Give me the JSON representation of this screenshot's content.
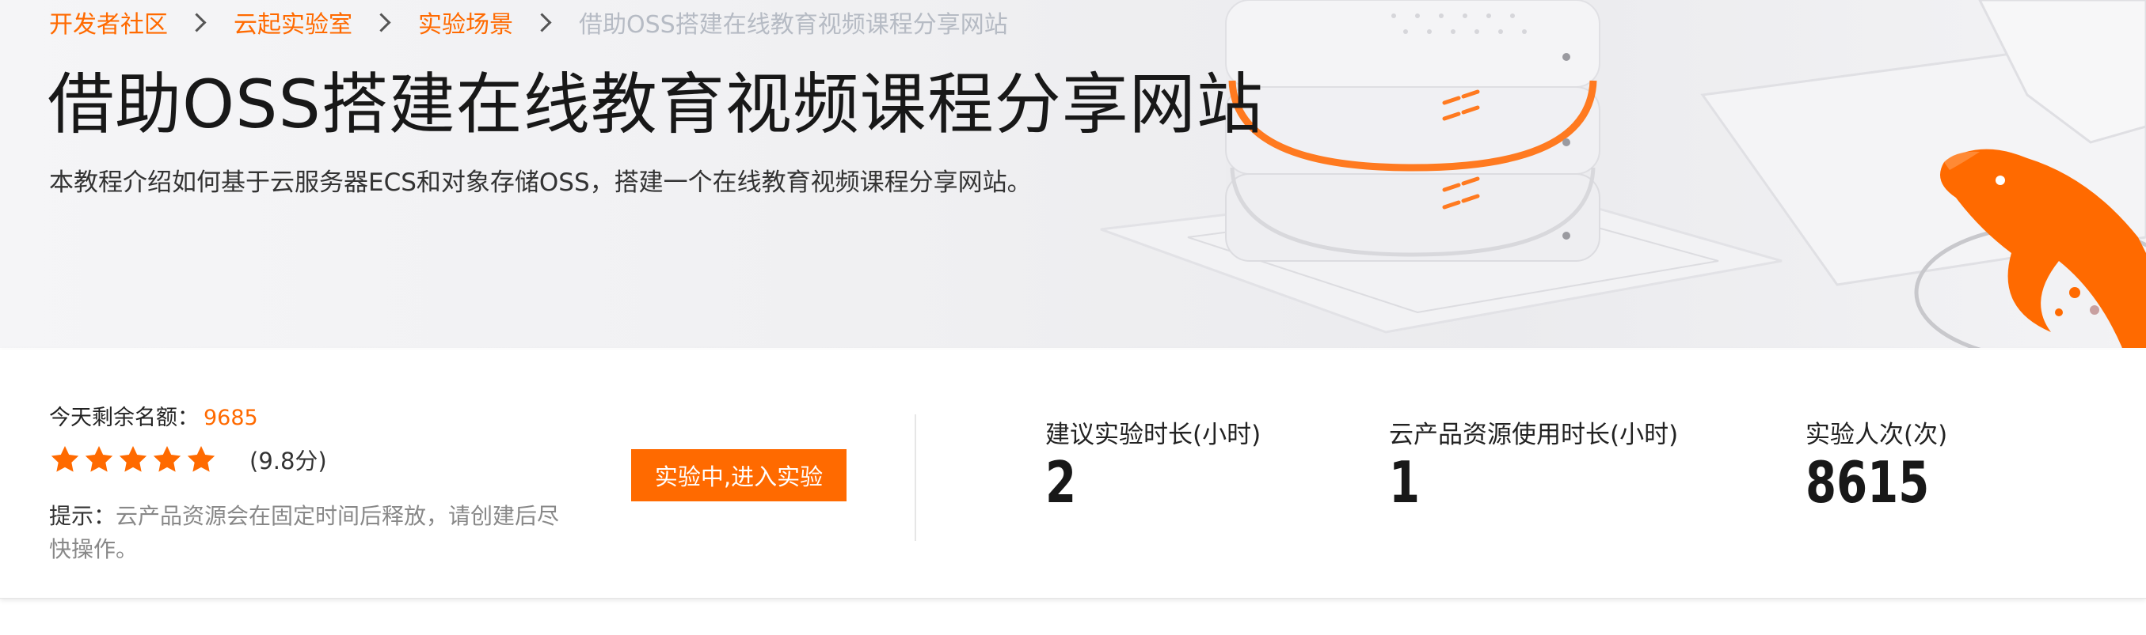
{
  "breadcrumb": {
    "items": [
      "开发者社区",
      "云起实验室",
      "实验场景"
    ],
    "current": "借助OSS搭建在线教育视频课程分享网站"
  },
  "page": {
    "title": "借助OSS搭建在线教育视频课程分享网站",
    "description": "本教程介绍如何基于云服务器ECS和对象存储OSS，搭建一个在线教育视频课程分享网站。"
  },
  "lab": {
    "quota_label": "今天剩余名额：",
    "quota_value": "9685",
    "rating_stars": 5,
    "rating_score": "(9.8分)",
    "tip_label": "提示：",
    "tip_text": "云产品资源会在固定时间后释放，请创建后尽快操作。",
    "enter_button": "实验中,进入实验"
  },
  "stats": [
    {
      "label": "建议实验时长(小时)",
      "value": "2"
    },
    {
      "label": "云产品资源使用时长(小时)",
      "value": "1"
    },
    {
      "label": "实验人次(次)",
      "value": "8615"
    }
  ],
  "colors": {
    "accent": "#ff6a00",
    "breadcrumb_current": "#b6bbc4"
  },
  "icons": {
    "breadcrumb_separator": "chevron-right-icon",
    "rating": "star-icon"
  }
}
